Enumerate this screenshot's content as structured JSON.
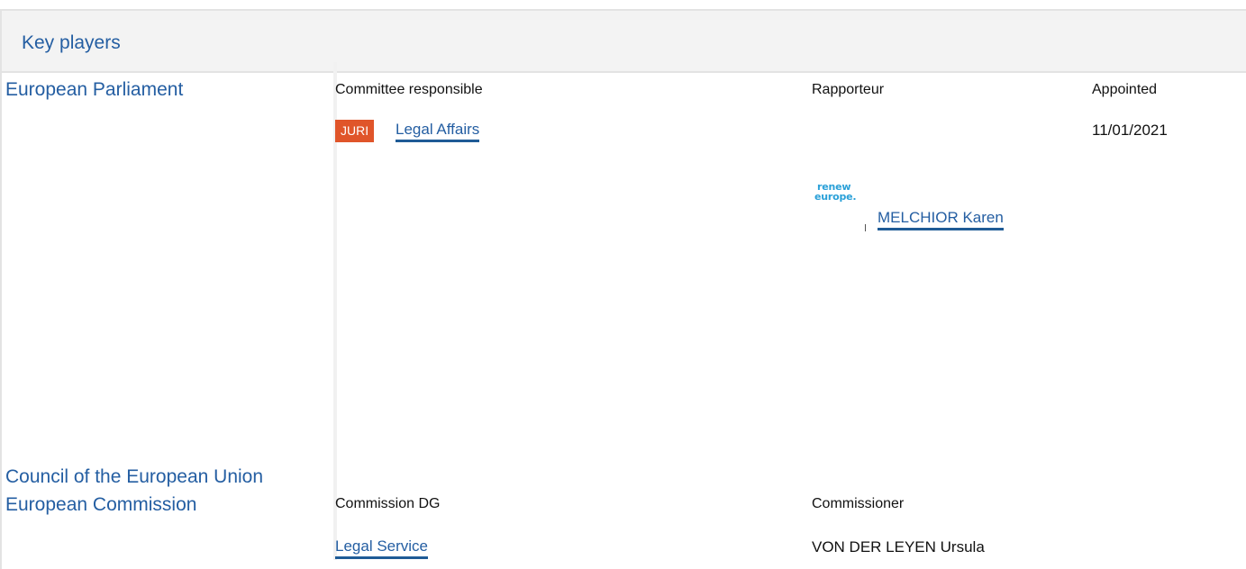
{
  "header": {
    "title": "Key players"
  },
  "institutions": {
    "parliament": "European Parliament",
    "council": "Council of the European Union",
    "commission": "European Commission"
  },
  "parliament": {
    "col_committee": "Committee responsible",
    "col_rapporteur": "Rapporteur",
    "col_appointed": "Appointed",
    "committee_code": "JURI",
    "committee_name": "Legal Affairs",
    "appointed_date": "11/01/2021",
    "group_logo": {
      "line1": "renew",
      "line2": "europe."
    },
    "rapporteur_name": "MELCHIOR Karen"
  },
  "commission": {
    "col_dg": "Commission DG",
    "col_commissioner": "Commissioner",
    "dg_name": "Legal Service",
    "commissioner_name": "VON DER LEYEN Ursula"
  },
  "colors": {
    "link": "#245ea2",
    "badge": "#e0552a",
    "header_bg": "#f3f3f3"
  }
}
